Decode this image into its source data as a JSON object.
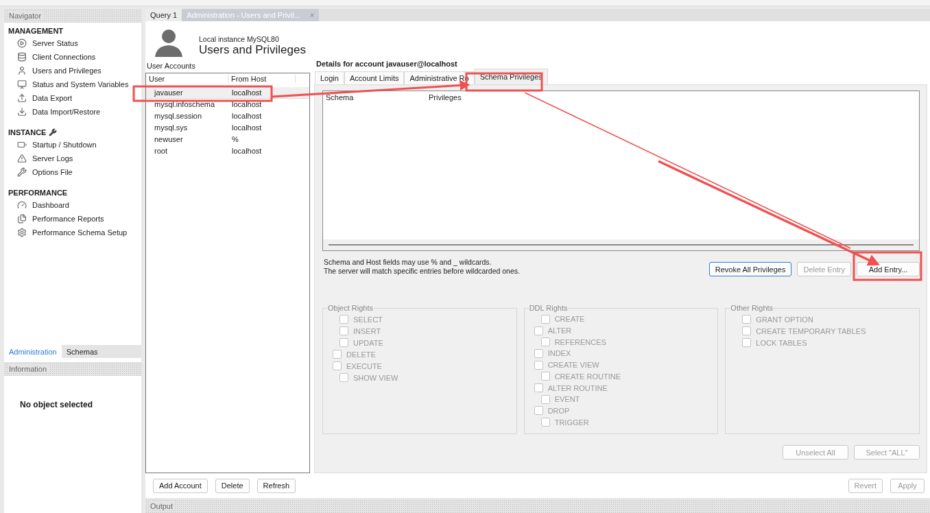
{
  "navigator": {
    "title": "Navigator",
    "sections": [
      {
        "heading": "MANAGEMENT",
        "items": [
          "Server Status",
          "Client Connections",
          "Users and Privileges",
          "Status and System Variables",
          "Data Export",
          "Data Import/Restore"
        ]
      },
      {
        "heading": "INSTANCE",
        "items": [
          "Startup / Shutdown",
          "Server Logs",
          "Options File"
        ]
      },
      {
        "heading": "PERFORMANCE",
        "items": [
          "Dashboard",
          "Performance Reports",
          "Performance Schema Setup"
        ]
      }
    ]
  },
  "bottom_tabs": [
    {
      "label": "Administration",
      "selected": true
    },
    {
      "label": "Schemas",
      "selected": false
    }
  ],
  "information": {
    "title": "Information",
    "message": "No object selected"
  },
  "editor_tabs": [
    {
      "label": "Query 1",
      "selected": false
    },
    {
      "label": "Administration - Users and Privil...",
      "selected": true,
      "close": "×"
    }
  ],
  "header": {
    "subtitle": "Local instance MySQL80",
    "title": "Users and Privileges"
  },
  "user_accounts": {
    "label": "User Accounts",
    "columns": [
      "User",
      "From Host"
    ],
    "rows": [
      {
        "user": "javauser",
        "host": "localhost",
        "selected": true
      },
      {
        "user": "mysql.infoschema",
        "host": "localhost",
        "selected": false
      },
      {
        "user": "mysql.session",
        "host": "localhost",
        "selected": false
      },
      {
        "user": "mysql.sys",
        "host": "localhost",
        "selected": false
      },
      {
        "user": "newuser",
        "host": "%",
        "selected": false
      },
      {
        "user": "root",
        "host": "localhost",
        "selected": false
      }
    ]
  },
  "account_buttons": [
    "Add Account",
    "Delete",
    "Refresh"
  ],
  "details": {
    "title": "Details for account javauser@localhost",
    "tabs": [
      {
        "label": "Login",
        "selected": false
      },
      {
        "label": "Account Limits",
        "selected": false
      },
      {
        "label": "Administrative Ro",
        "selected": false
      },
      {
        "label": "Schema Privileges",
        "selected": true
      }
    ],
    "schema_columns": [
      "Schema",
      "Privileges"
    ],
    "hint": [
      "Schema and Host fields may use % and _ wildcards.",
      "The server will match specific entries before wildcarded ones."
    ],
    "entry_buttons": [
      {
        "label": "Revoke All Privileges",
        "disabled": false,
        "default": true
      },
      {
        "label": "Delete Entry",
        "disabled": true,
        "default": false
      },
      {
        "label": "Add Entry...",
        "disabled": false,
        "default": false
      }
    ],
    "rights_groups": [
      {
        "title": "Object Rights",
        "items": [
          {
            "label": "SELECT",
            "checked": false,
            "disabled": true,
            "indented": true
          },
          {
            "label": "INSERT",
            "checked": false,
            "disabled": true,
            "indented": true
          },
          {
            "label": "UPDATE",
            "checked": false,
            "disabled": true,
            "indented": true
          },
          {
            "label": "DELETE",
            "checked": false,
            "disabled": true,
            "indented": false
          },
          {
            "label": "EXECUTE",
            "checked": false,
            "disabled": true,
            "indented": false
          },
          {
            "label": "SHOW VIEW",
            "checked": false,
            "disabled": true,
            "indented": true
          }
        ]
      },
      {
        "title": "DDL Rights",
        "items": [
          {
            "label": "CREATE",
            "checked": false,
            "disabled": true,
            "indented": true
          },
          {
            "label": "ALTER",
            "checked": false,
            "disabled": true,
            "indented": false
          },
          {
            "label": "REFERENCES",
            "checked": false,
            "disabled": true,
            "indented": true
          },
          {
            "label": "INDEX",
            "checked": false,
            "disabled": true,
            "indented": false
          },
          {
            "label": "CREATE VIEW",
            "checked": false,
            "disabled": true,
            "indented": false
          },
          {
            "label": "CREATE ROUTINE",
            "checked": false,
            "disabled": true,
            "indented": true
          },
          {
            "label": "ALTER ROUTINE",
            "checked": false,
            "disabled": true,
            "indented": false
          },
          {
            "label": "EVENT",
            "checked": false,
            "disabled": true,
            "indented": true
          },
          {
            "label": "DROP",
            "checked": false,
            "disabled": true,
            "indented": false
          },
          {
            "label": "TRIGGER",
            "checked": false,
            "disabled": true,
            "indented": true
          }
        ]
      },
      {
        "title": "Other Rights",
        "items": [
          {
            "label": "GRANT OPTION",
            "checked": false,
            "disabled": true,
            "indented": true
          },
          {
            "label": "CREATE TEMPORARY TABLES",
            "checked": false,
            "disabled": true,
            "indented": true
          },
          {
            "label": "LOCK TABLES",
            "checked": false,
            "disabled": true,
            "indented": true
          }
        ]
      }
    ],
    "select_buttons": [
      {
        "label": "Unselect All",
        "disabled": true
      },
      {
        "label": "Select \"ALL\"",
        "disabled": true
      }
    ]
  },
  "apply_buttons": [
    {
      "label": "Revert",
      "disabled": true
    },
    {
      "label": "Apply",
      "disabled": true
    }
  ],
  "output": {
    "title": "Output"
  }
}
